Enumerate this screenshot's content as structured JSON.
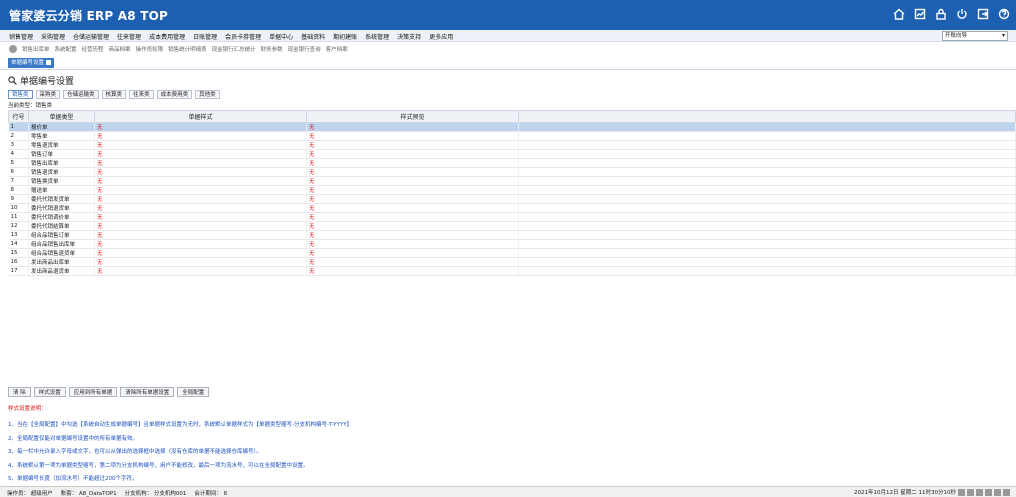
{
  "app": {
    "title": "管家婆云分销 ERP A8 TOP",
    "icons": [
      "home-icon",
      "dashboard-icon",
      "lock-icon",
      "power-icon",
      "logout-icon",
      "help-icon"
    ]
  },
  "menu": {
    "items": [
      "销售管理",
      "采购管理",
      "仓储运输管理",
      "往来管理",
      "成本费用管理",
      "日账管理",
      "会员卡券管理",
      "单据中心",
      "基础资料",
      "期初建账",
      "系统管理",
      "决策支持",
      "更多应用"
    ],
    "nav_select": "开账向导"
  },
  "quickbar": {
    "items": [
      "销售出库单",
      "系统配置",
      "经营历程",
      "商品档案",
      "操作员权限",
      "销售统计明细表",
      "现金银行汇总统计",
      "财务参数",
      "现金银行查询",
      "客户档案"
    ]
  },
  "doc_tab": {
    "label": "单据编号设置"
  },
  "page": {
    "title": "单据编号设置",
    "type_tabs": [
      "销售类",
      "采购类",
      "仓储运输类",
      "核算类",
      "往来类",
      "成本费用类",
      "其他类"
    ],
    "current_type": "当前类型：销售类"
  },
  "grid": {
    "columns": [
      "行号",
      "单据类型",
      "单据样式",
      "样式预览"
    ],
    "rows": [
      {
        "no": "1",
        "type": "报价单",
        "style": "无",
        "preview": "无"
      },
      {
        "no": "2",
        "type": "零售单",
        "style": "无",
        "preview": "无"
      },
      {
        "no": "3",
        "type": "零售退货单",
        "style": "无",
        "preview": "无"
      },
      {
        "no": "4",
        "type": "销售订单",
        "style": "无",
        "preview": "无"
      },
      {
        "no": "5",
        "type": "销售出库单",
        "style": "无",
        "preview": "无"
      },
      {
        "no": "6",
        "type": "销售退货单",
        "style": "无",
        "preview": "无"
      },
      {
        "no": "7",
        "type": "销售换货单",
        "style": "无",
        "preview": "无"
      },
      {
        "no": "8",
        "type": "赠送单",
        "style": "无",
        "preview": "无"
      },
      {
        "no": "9",
        "type": "委托代销发货单",
        "style": "无",
        "preview": "无"
      },
      {
        "no": "10",
        "type": "委托代销退货单",
        "style": "无",
        "preview": "无"
      },
      {
        "no": "11",
        "type": "委托代销调价单",
        "style": "无",
        "preview": "无"
      },
      {
        "no": "12",
        "type": "委托代销结算单",
        "style": "无",
        "preview": "无"
      },
      {
        "no": "13",
        "type": "组合品销售订单",
        "style": "无",
        "preview": "无"
      },
      {
        "no": "14",
        "type": "组合品销售出库单",
        "style": "无",
        "preview": "无"
      },
      {
        "no": "15",
        "type": "组合品销售退货单",
        "style": "无",
        "preview": "无"
      },
      {
        "no": "16",
        "type": "发出商品出库单",
        "style": "无",
        "preview": "无"
      },
      {
        "no": "17",
        "type": "发出商品退货单",
        "style": "无",
        "preview": "无"
      }
    ],
    "selected_row": 1
  },
  "buttons": [
    "清 除",
    "样式设置",
    "应用到所有单据",
    "清除所有单据设置",
    "全局配置"
  ],
  "notes": {
    "heading": "样式设置说明：",
    "lines": [
      "1、当在【全局配置】中勾选【系统自动生成单据编号】且单据样式设置为无时，系统默认单据样式为【单据类型缩写-分支机构编号-T-YYYY】",
      "2、全局配置仅能对单据编号设置中的所有单据有效。",
      "3、每一栏中允许录入字母或文字，也可以从弹出的选择框中选择（没有仓库的单据不能选择仓库编号）。",
      "4、系统默认第一项为单据类型缩写，第二项为分支机构编号，用户不能修改，最后一项为流水号，可以在全局配置中设置。",
      "5、单据编号长度（加流水号）不能超过200个字符。"
    ]
  },
  "status": {
    "operator": "操作员：  超级用户",
    "account": "账套：  A8_DataTOP1",
    "branch": "分支机构：  分支机构001",
    "period": "会计期间：  8",
    "datetime": "2021年10月12日 星期二 11时30分10秒"
  }
}
